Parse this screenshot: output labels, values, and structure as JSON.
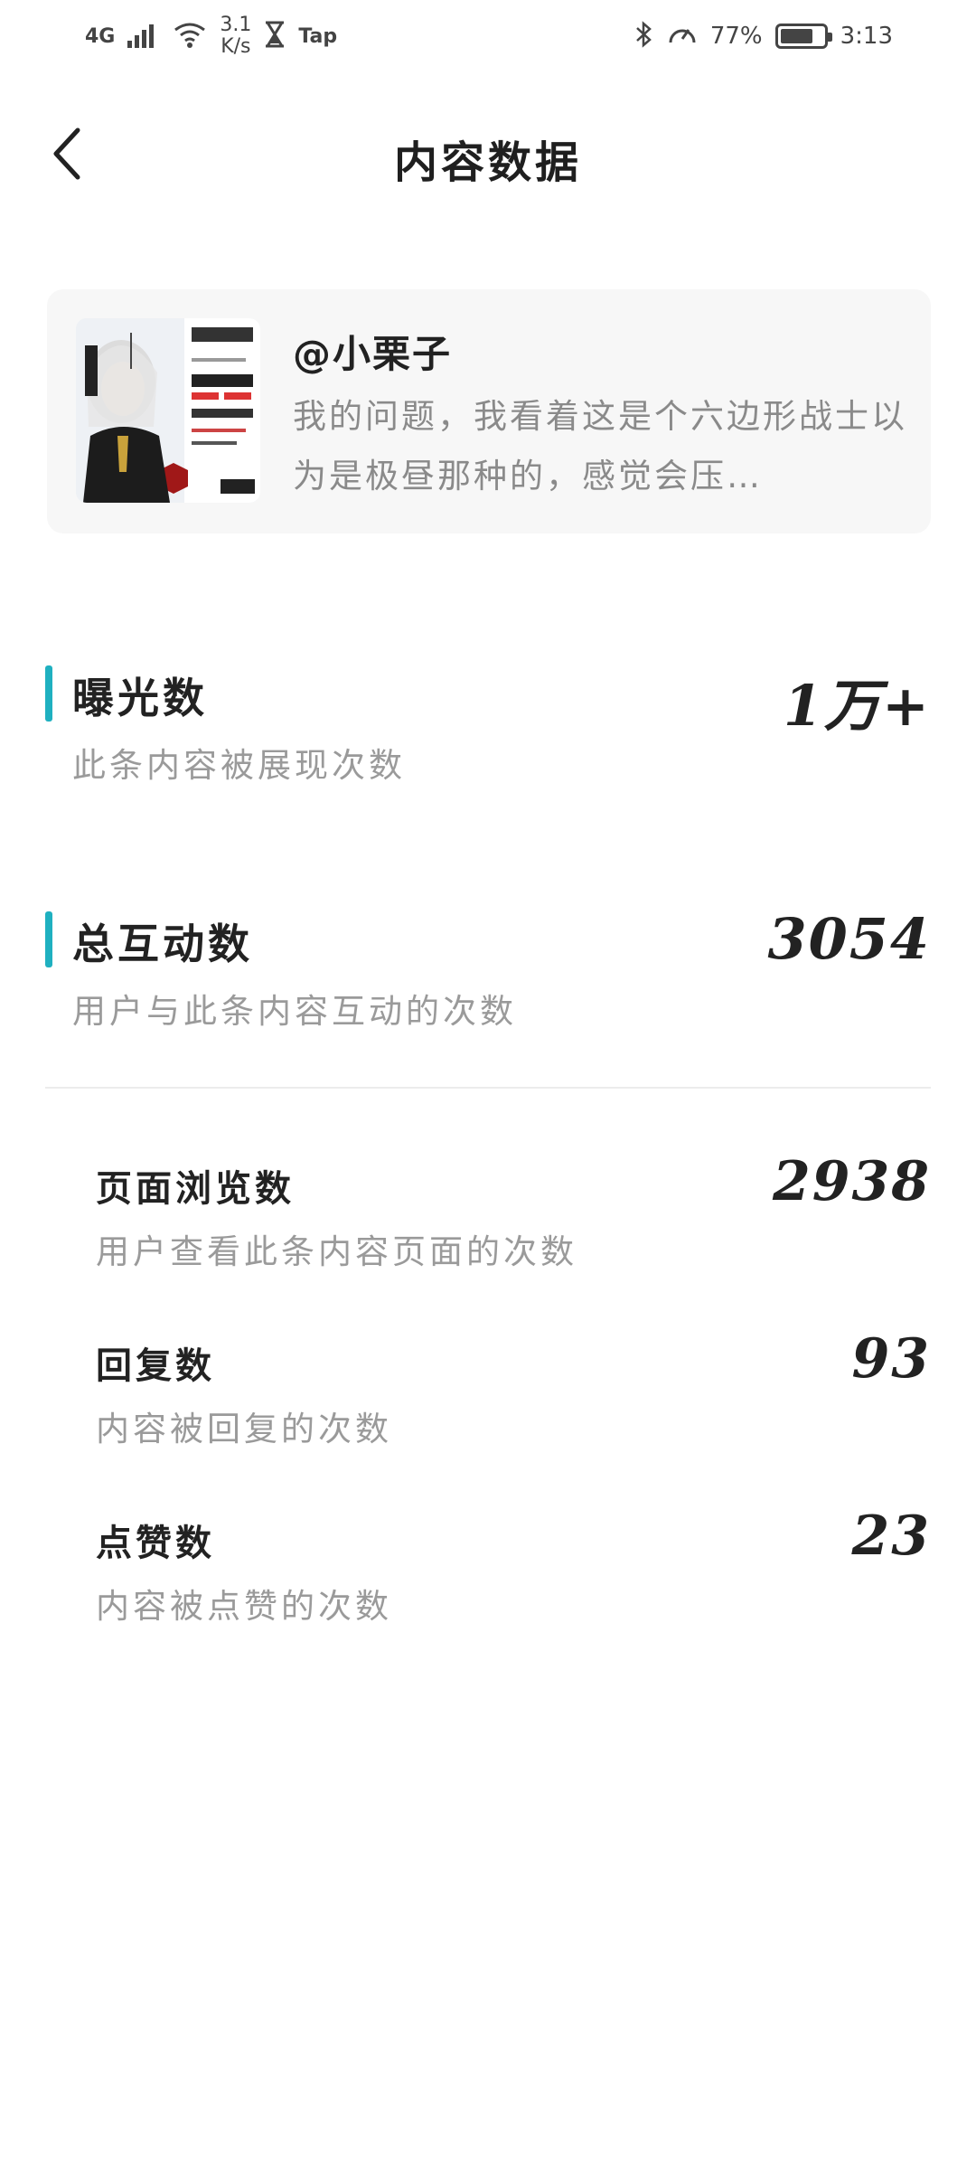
{
  "status_bar": {
    "network": "4G",
    "speed_value": "3.1",
    "speed_unit": "K/s",
    "app_label": "Tap",
    "battery_percent": "77%",
    "battery_level": 0.77,
    "time": "3:13"
  },
  "header": {
    "title": "内容数据"
  },
  "post": {
    "author": "@小栗子",
    "excerpt": "我的问题，我看着这是个六边形战士以为是极昼那种的，感觉会压…"
  },
  "metrics": {
    "exposure": {
      "label": "曝光数",
      "desc": "此条内容被展现次数",
      "value": "1万+"
    },
    "interactions": {
      "label": "总互动数",
      "desc": "用户与此条内容互动的次数",
      "value": "3054"
    }
  },
  "sub_metrics": {
    "page_views": {
      "label": "页面浏览数",
      "desc": "用户查看此条内容页面的次数",
      "value": "2938"
    },
    "replies": {
      "label": "回复数",
      "desc": "内容被回复的次数",
      "value": "93"
    },
    "likes": {
      "label": "点赞数",
      "desc": "内容被点赞的次数",
      "value": "23"
    }
  },
  "colors": {
    "accent": "#1fb0c0",
    "card_bg": "#f7f7f7",
    "desc_text": "#9a9a9a"
  }
}
